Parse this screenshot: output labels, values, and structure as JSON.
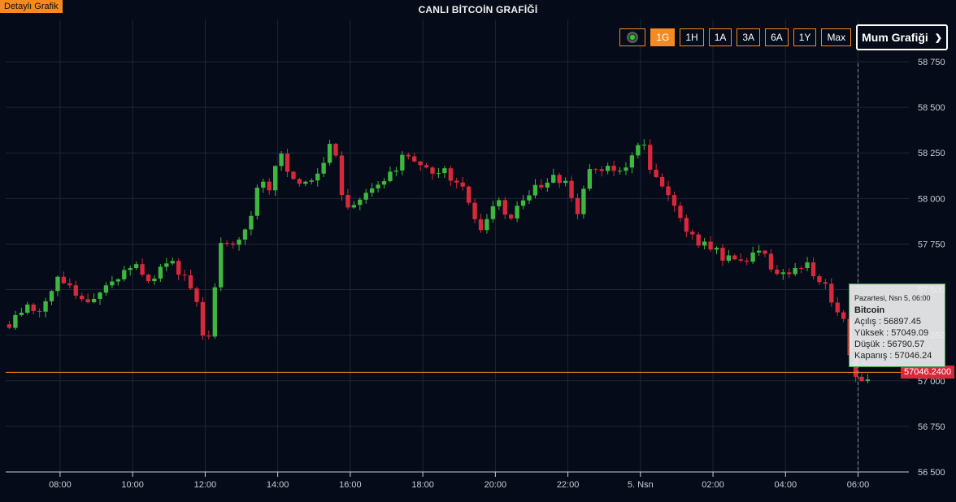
{
  "header": {
    "detail_link": "Detaylı Grafik",
    "title": "CANLI BİTCOİN GRAFİĞİ"
  },
  "toolbar": {
    "live_color": "#27d127",
    "ranges": [
      "1G",
      "1H",
      "1A",
      "3A",
      "6A",
      "1Y",
      "Max"
    ],
    "active_range": "1G",
    "chart_type_selected": "Mum Grafiği"
  },
  "colors": {
    "background": "#050b18",
    "up": "#3fb63f",
    "down": "#d8283b",
    "accent": "#f6891f",
    "grid": "#1e2635"
  },
  "tooltip": {
    "date": "Pazartesi, Nsn 5, 06:00",
    "name": "Bitcoin",
    "open": "Açılış : 56897.45",
    "high": "Yüksek : 57049.09",
    "low": "Düşük : 56790.57",
    "close": "Kapanış : 57046.24"
  },
  "last_price_label": "57046.2400",
  "chart_data": {
    "type": "candlestick",
    "x_ticks": [
      "08:00",
      "10:00",
      "12:00",
      "14:00",
      "16:00",
      "18:00",
      "20:00",
      "22:00",
      "5. Nsn",
      "02:00",
      "04:00",
      "06:00"
    ],
    "x_tick_hours": [
      8,
      10,
      12,
      14,
      16,
      18,
      20,
      22,
      24,
      26,
      28,
      30
    ],
    "x_range_hours": [
      6.5,
      31.4
    ],
    "y_ticks": [
      "58 750",
      "58 500",
      "58 250",
      "58 000",
      "57 750",
      "57 500",
      "57 250",
      "57 000",
      "56 750",
      "56 500"
    ],
    "y_tick_values": [
      58750,
      58500,
      58250,
      58000,
      57750,
      57500,
      57250,
      57000,
      56750,
      56500
    ],
    "ylim": [
      56500,
      58750
    ],
    "last_price": 57046.24,
    "grid": true,
    "candle_minutes": 10,
    "close_path": [
      [
        6.6,
        57310
      ],
      [
        7.0,
        57400
      ],
      [
        7.5,
        57380
      ],
      [
        7.9,
        57560
      ],
      [
        8.4,
        57480
      ],
      [
        9.0,
        57430
      ],
      [
        9.5,
        57570
      ],
      [
        10.0,
        57640
      ],
      [
        10.5,
        57560
      ],
      [
        11.0,
        57650
      ],
      [
        11.5,
        57570
      ],
      [
        11.8,
        57440
      ],
      [
        12.0,
        57140
      ],
      [
        12.2,
        57400
      ],
      [
        12.4,
        57780
      ],
      [
        12.8,
        57740
      ],
      [
        13.2,
        57860
      ],
      [
        13.5,
        58100
      ],
      [
        13.8,
        58010
      ],
      [
        14.0,
        58260
      ],
      [
        14.4,
        58120
      ],
      [
        14.8,
        58060
      ],
      [
        15.2,
        58150
      ],
      [
        15.5,
        58360
      ],
      [
        15.7,
        58060
      ],
      [
        16.0,
        57910
      ],
      [
        16.4,
        58030
      ],
      [
        17.0,
        58090
      ],
      [
        17.5,
        58240
      ],
      [
        18.0,
        58180
      ],
      [
        18.6,
        58140
      ],
      [
        19.2,
        58020
      ],
      [
        19.6,
        57800
      ],
      [
        20.0,
        57990
      ],
      [
        20.4,
        57890
      ],
      [
        21.0,
        58040
      ],
      [
        21.5,
        58110
      ],
      [
        22.0,
        58080
      ],
      [
        22.2,
        57880
      ],
      [
        22.5,
        58130
      ],
      [
        23.0,
        58160
      ],
      [
        23.6,
        58180
      ],
      [
        24.0,
        58330
      ],
      [
        24.3,
        58160
      ],
      [
        24.8,
        57990
      ],
      [
        25.3,
        57800
      ],
      [
        25.8,
        57740
      ],
      [
        26.2,
        57690
      ],
      [
        26.8,
        57650
      ],
      [
        27.3,
        57720
      ],
      [
        27.8,
        57560
      ],
      [
        28.2,
        57610
      ],
      [
        28.6,
        57630
      ],
      [
        29.2,
        57480
      ],
      [
        29.6,
        57330
      ],
      [
        30.0,
        56940
      ],
      [
        30.3,
        57046
      ]
    ]
  }
}
